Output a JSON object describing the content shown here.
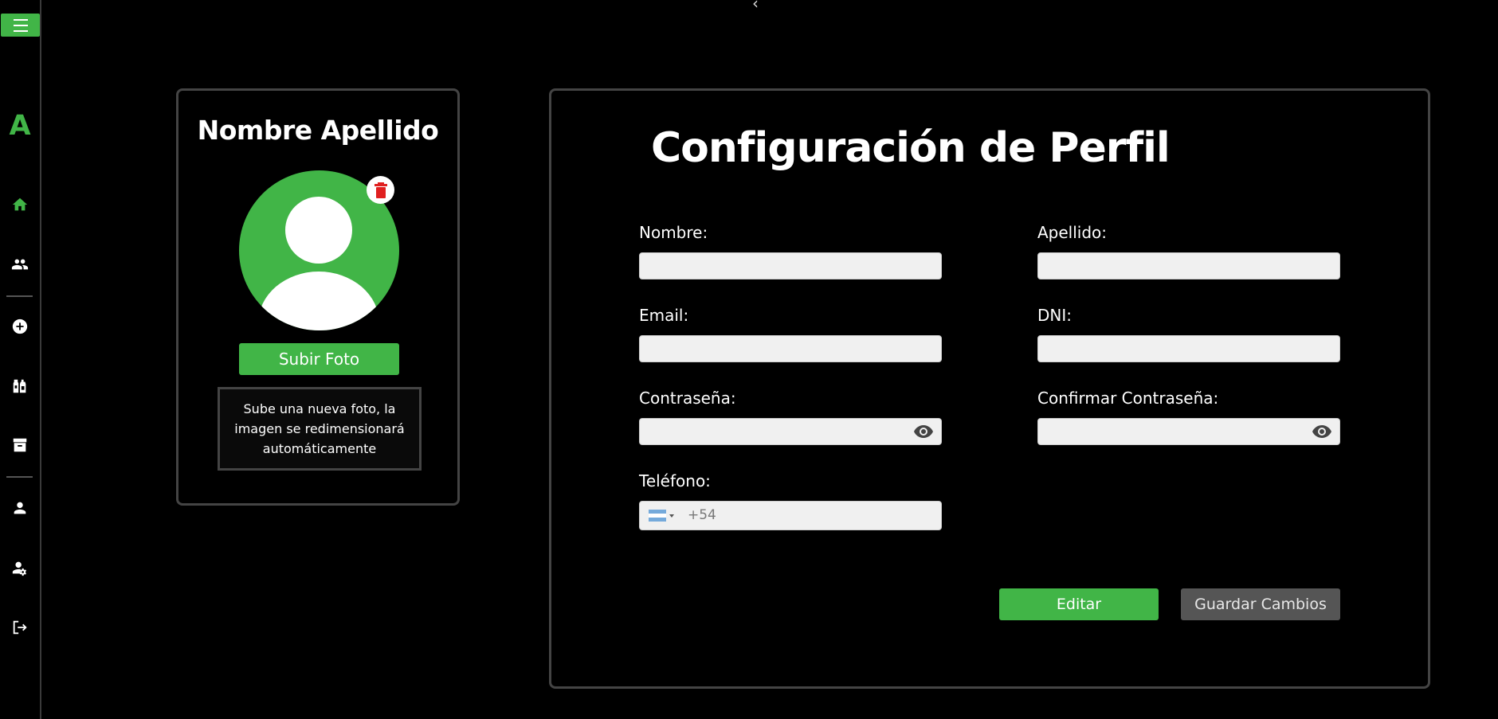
{
  "sidebar": {
    "logo": "A",
    "icons": [
      "menu-icon",
      "home-icon",
      "group-icon",
      "add-circle-icon",
      "bottles-icon",
      "archive-icon",
      "person-icon",
      "person-settings-icon",
      "logout-icon"
    ]
  },
  "profile": {
    "name": "Nombre Apellido",
    "upload_label": "Subir Foto",
    "upload_hint": "Sube una nueva foto, la imagen se redimensionará automáticamente"
  },
  "settings": {
    "title": "Configuración de Perfil",
    "fields": {
      "nombre": {
        "label": "Nombre:",
        "value": ""
      },
      "apellido": {
        "label": "Apellido:",
        "value": ""
      },
      "email": {
        "label": "Email:",
        "value": ""
      },
      "dni": {
        "label": "DNI:",
        "value": ""
      },
      "password": {
        "label": "Contraseña:",
        "value": ""
      },
      "confirm_password": {
        "label": "Confirmar Contraseña:",
        "value": ""
      },
      "telefono": {
        "label": "Teléfono:",
        "prefix": "+54"
      }
    },
    "edit_label": "Editar",
    "save_label": "Guardar Cambios"
  },
  "colors": {
    "accent": "#41b547",
    "background": "#000000",
    "delete": "#e02020"
  }
}
